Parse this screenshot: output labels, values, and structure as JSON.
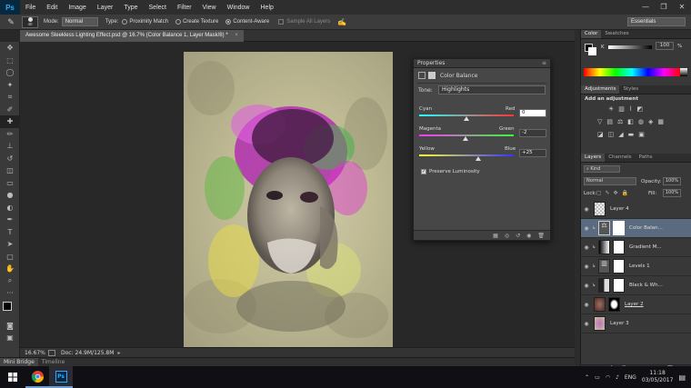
{
  "menu": {
    "app_logo": "Ps",
    "items": [
      "File",
      "Edit",
      "Image",
      "Layer",
      "Type",
      "Select",
      "Filter",
      "View",
      "Window",
      "Help"
    ]
  },
  "options": {
    "brush_size": "40",
    "mode_label": "Mode:",
    "mode_value": "Normal",
    "type_label": "Type:",
    "proximity": "Proximity Match",
    "create_texture": "Create Texture",
    "content_aware": "Content-Aware",
    "sample_all": "Sample All Layers",
    "workspace": "Essentials"
  },
  "document": {
    "tab_title": "Awesome Sleekless Lighting Effect.psd @ 16.7% (Color Balance 1, Layer Mask/8) *",
    "zoom": "16.67%",
    "doc_info": "Doc: 24.9M/125.8M"
  },
  "bridge": {
    "mini_bridge": "Mini Bridge",
    "timeline": "Timeline"
  },
  "color_panel": {
    "tab_color": "Color",
    "tab_swatches": "Swatches",
    "k_label": "K",
    "k_value": "100",
    "pct": "%"
  },
  "adjustments_panel": {
    "tab_adjustments": "Adjustments",
    "tab_styles": "Styles",
    "add_label": "Add an adjustment"
  },
  "layers_panel": {
    "tab_layers": "Layers",
    "tab_channels": "Channels",
    "tab_paths": "Paths",
    "kind_label": "Kind",
    "blend_mode": "Normal",
    "opacity_label": "Opacity:",
    "opacity_value": "100%",
    "lock_label": "Lock:",
    "fill_label": "Fill:",
    "fill_value": "100%",
    "layers": [
      {
        "name": "Layer 4"
      },
      {
        "name": "Color Balan..."
      },
      {
        "name": "Gradient M..."
      },
      {
        "name": "Levels 1"
      },
      {
        "name": "Black & Wh..."
      },
      {
        "name": "Layer 2"
      },
      {
        "name": "Layer 3"
      }
    ]
  },
  "properties": {
    "header": "Properties",
    "title": "Color Balance",
    "tone_label": "Tone:",
    "tone_value": "Highlights",
    "sliders": [
      {
        "left": "Cyan",
        "right": "Red",
        "value": "0",
        "level": 0
      },
      {
        "left": "Magenta",
        "right": "Green",
        "value": "-2",
        "level": -2
      },
      {
        "left": "Yellow",
        "right": "Blue",
        "value": "+25",
        "level": 25
      }
    ],
    "preserve": "Preserve Luminosity"
  },
  "taskbar": {
    "lang": "ENG",
    "time": "11:18",
    "date": "03/05/2017"
  },
  "colors": {
    "accent": "#31a8ff",
    "panel_bg": "#383838",
    "canvas_bg": "#282828"
  }
}
